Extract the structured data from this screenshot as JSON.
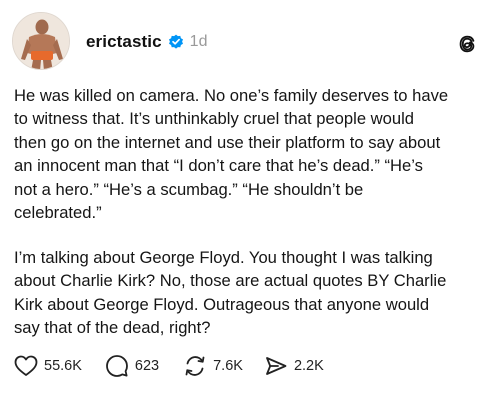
{
  "post": {
    "username": "erictastic",
    "timestamp": "1d",
    "paragraphs": [
      "He was killed on camera. No one’s family deserves to have\nto witness that. It’s unthinkably cruel that people would\nthen go on the internet and use their platform to say about\nan innocent man that “I don’t care that he’s dead.” “He’s\nnot a hero.” “He’s a scumbag.” “He shouldn’t be\ncelebrated.”",
      "I’m talking about George Floyd. You thought I was talking\nabout Charlie Kirk? No, those are actual quotes BY Charlie\nKirk about George Floyd. Outrageous that anyone would\nsay that of the dead, right?"
    ],
    "stats": {
      "likes": "55.6K",
      "replies": "623",
      "reposts": "7.6K",
      "shares": "2.2K"
    }
  },
  "icons": {
    "verified": "verified-badge-icon",
    "app": "threads-logo-icon",
    "like": "heart-icon",
    "reply": "speech-bubble-icon",
    "repost": "repost-arrows-icon",
    "share": "send-icon"
  },
  "colors": {
    "verified_blue": "#0095f6",
    "text": "#151515",
    "muted": "#9a9a9a"
  }
}
